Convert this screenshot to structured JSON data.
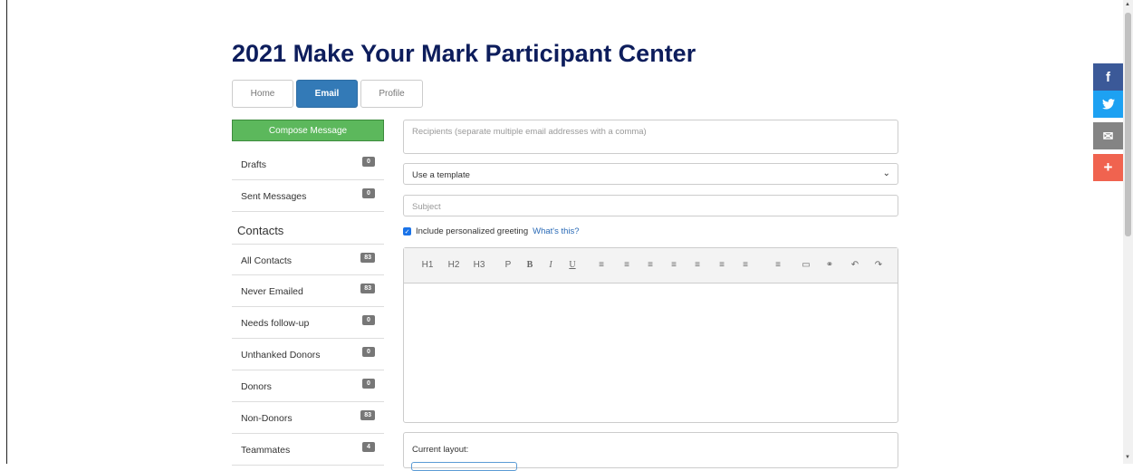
{
  "page_title": "2021 Make Your Mark Participant Center",
  "tabs": [
    {
      "label": "Home"
    },
    {
      "label": "Email"
    },
    {
      "label": "Profile"
    }
  ],
  "compose_label": "Compose Message",
  "sidebar": {
    "folders": [
      {
        "label": "Drafts",
        "count": "0"
      },
      {
        "label": "Sent Messages",
        "count": "0"
      }
    ],
    "contacts_heading": "Contacts",
    "contacts": [
      {
        "label": "All Contacts",
        "count": "83"
      },
      {
        "label": "Never Emailed",
        "count": "83"
      },
      {
        "label": "Needs follow-up",
        "count": "0"
      },
      {
        "label": "Unthanked Donors",
        "count": "0"
      },
      {
        "label": "Donors",
        "count": "0"
      },
      {
        "label": "Non-Donors",
        "count": "83"
      },
      {
        "label": "Teammates",
        "count": "4"
      }
    ]
  },
  "form": {
    "recipients_placeholder": "Recipients (separate multiple email addresses with a comma)",
    "template_value": "Use a template",
    "subject_placeholder": "Subject",
    "greeting_label": "Include personalized greeting",
    "greeting_help_link": "What's this?",
    "greeting_checked": true
  },
  "toolbar": [
    "H1",
    "H2",
    "H3",
    "P",
    "B",
    "I",
    "U",
    "≡",
    "≡",
    "≡",
    "≡",
    "≡",
    "≡",
    "≡",
    "≡",
    "▭",
    "⚭",
    "↶",
    "↷"
  ],
  "toolbar_icons": [
    "heading-1",
    "heading-2",
    "heading-3",
    "paragraph",
    "bold",
    "italic",
    "underline",
    "bullet-list-icon",
    "numbered-list-icon",
    "align-left-icon",
    "align-center-icon",
    "align-right-icon",
    "justify-icon",
    "outdent-icon",
    "indent-icon",
    "image-icon",
    "link-icon",
    "undo-icon",
    "redo-icon"
  ],
  "layout_label": "Current layout:",
  "share_buttons": [
    {
      "icon": "facebook-icon",
      "glyph": "f",
      "color": "#3b5998"
    },
    {
      "icon": "twitter-icon",
      "glyph": "🐦",
      "color": "#1da1f2"
    },
    {
      "icon": "email-icon",
      "glyph": "✉",
      "color": "#848484"
    },
    {
      "icon": "more-share-icon",
      "glyph": "+",
      "color": "#f0634f"
    }
  ]
}
